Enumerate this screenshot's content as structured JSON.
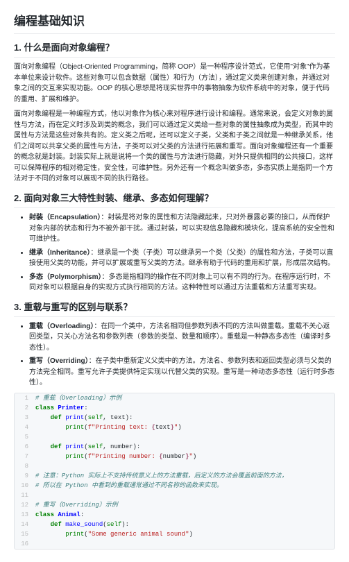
{
  "title": "编程基础知识",
  "s1": {
    "heading": "1. 什么是面向对象编程？",
    "p1": "面向对象编程（Object-Oriented Programming，简称 OOP）是一种程序设计范式，它使用\"对象\"作为基本单位来设计软件。这些对象可以包含数据（属性）和行为（方法），通过定义类来创建对象，并通过对象之间的交互来实现功能。OOP 的核心思想是将现实世界中的事物抽象为软件系统中的对象，便于代码的重用、扩展和维护。",
    "p2": "面向对象编程是一种编程方式，他以对象作为核心来对程序进行设计和编程。通常来说，会定义对象的属性与方法，而在定义时涉及到类的概念，我们可以通过定义类给一些对象的属性抽象成为类型，而其中的属性与方法是这些对象共有的。定义类之后呢，还可以定义子类，父类和子类之间就是一种继承关系，他们之间可以共享父类的属性与方法，子类可以对父类的方法进行拓展和重写。面向对象编程还有一个重要的概念就是封装。封装实际上就是说将一个类的属性与方法进行隐藏，对外只提供相同的公共接口，这样可以保障程序的相对稳定性，安全性，可维护性。另外还有一个概念叫做多态，多态实质上是指同一个方法对于不同的对象可以展现不同的执行路径。"
  },
  "s2": {
    "heading": "2. 面向对象三大特性封装、继承、多态如何理解？",
    "items": [
      {
        "b": "封装（Encapsulation）",
        "t": "：封装是将对象的属性和方法隐藏起来，只对外暴露必要的接口，从而保护对象内部的状态和行为不被外部干扰。通过封装，可以实现信息隐藏和模块化，提高系统的安全性和可维护性。"
      },
      {
        "b": "继承（Inheritance）",
        "t": "：继承是一个类（子类）可以继承另一个类（父类）的属性和方法，子类可以直接使用父类的功能，并可以扩展或重写父类的方法。继承有助于代码的重用和扩展，形成层次结构。"
      },
      {
        "b": "多态（Polymorphism）",
        "t": "：多态是指相同的操作在不同对象上可以有不同的行为。在程序运行时，不同对象可以根据自身的实现方式执行相同的方法。这种特性可以通过方法重载和方法重写实现。"
      }
    ]
  },
  "s3": {
    "heading": "3. 重载与重写的区别与联系？",
    "items": [
      {
        "b": "重载（Overloading）",
        "t": "：在同一个类中，方法名相同但参数列表不同的方法叫做重载。重载不关心返回类型，只关心方法名和参数列表（参数的类型、数量和顺序）。重载是一种静态多态性（编译时多态性）。"
      },
      {
        "b": "重写（Overriding）",
        "t": "：在子类中重新定义父类中的方法。方法名、参数列表和返回类型必须与父类的方法完全相同。重写允许子类提供特定实现以代替父类的实现。重写是一种动态多态性（运行时多态性）。"
      }
    ]
  },
  "code": {
    "l1_a": "# 重载（Overloading）示例",
    "l2_a": "class",
    "l2_b": " ",
    "l2_c": "Printer",
    "l2_d": ":",
    "l3_a": "    ",
    "l3_b": "def",
    "l3_c": " ",
    "l3_d": "print",
    "l3_e": "(",
    "l3_f": "self",
    "l3_g": ", text):",
    "l4_a": "        ",
    "l4_b": "print",
    "l4_c": "(",
    "l4_d": "f\"Printing text: ",
    "l4_e": "{",
    "l4_f": "text",
    "l4_g": "}",
    "l4_h": "\"",
    "l4_i": ")",
    "l6_a": "    ",
    "l6_b": "def",
    "l6_c": " ",
    "l6_d": "print",
    "l6_e": "(",
    "l6_f": "self",
    "l6_g": ", number):",
    "l7_a": "        ",
    "l7_b": "print",
    "l7_c": "(",
    "l7_d": "f\"Printing number: ",
    "l7_e": "{",
    "l7_f": "number",
    "l7_g": "}",
    "l7_h": "\"",
    "l7_i": ")",
    "l9_a": "# 注意：Python 实际上不支持传统意义上的方法重载，后定义的方法会覆盖前面的方法，",
    "l10_a": "# 所以在 Python 中看到的重载通常通过不同名称的函数来实现。",
    "l12_a": "# 重写（Overriding）示例",
    "l13_a": "class",
    "l13_b": " ",
    "l13_c": "Animal",
    "l13_d": ":",
    "l14_a": "    ",
    "l14_b": "def",
    "l14_c": " ",
    "l14_d": "make_sound",
    "l14_e": "(",
    "l14_f": "self",
    "l14_g": "):",
    "l15_a": "        ",
    "l15_b": "print",
    "l15_c": "(",
    "l15_d": "\"Some generic animal sound\"",
    "l15_e": ")"
  }
}
